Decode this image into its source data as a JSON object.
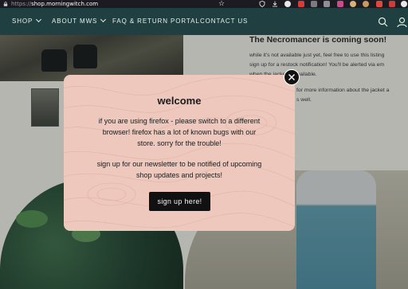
{
  "browser": {
    "url_prefix": "https://",
    "url_host": "shop.morningwitch.com",
    "icons": [
      "lock-icon",
      "star-icon",
      "shield-icon",
      "download-icon",
      "extension-icons"
    ]
  },
  "nav": {
    "items": [
      {
        "label": "SHOP",
        "has_dropdown": true
      },
      {
        "label": "ABOUT MWS",
        "has_dropdown": true
      },
      {
        "label": "FAQ & RETURN PORTAL",
        "has_dropdown": false
      },
      {
        "label": "CONTACT US",
        "has_dropdown": false
      }
    ],
    "icons": [
      "search-icon",
      "account-icon"
    ],
    "background_color": "#1f3f41"
  },
  "product": {
    "title": "The Necromancer is coming soon!",
    "description_lines": [
      "while it's not available just yet, feel free to use this listing",
      "sign up for a restock notification! You'll be alerted via em",
      "when the jacket is available.",
      "for more information about the jacket a",
      "s well."
    ]
  },
  "modal": {
    "title": "welcome",
    "paragraph_1": [
      "if you are using firefox - please switch to a different",
      "browser! firefox has a lot of known bugs with our",
      "store. sorry for the trouble!"
    ],
    "paragraph_2": [
      "sign up for our newsletter to be notified of upcoming",
      "shop updates and projects!"
    ],
    "button_label": "sign up here!",
    "close_icon": "close-icon",
    "background_color": "#eec8bc"
  }
}
